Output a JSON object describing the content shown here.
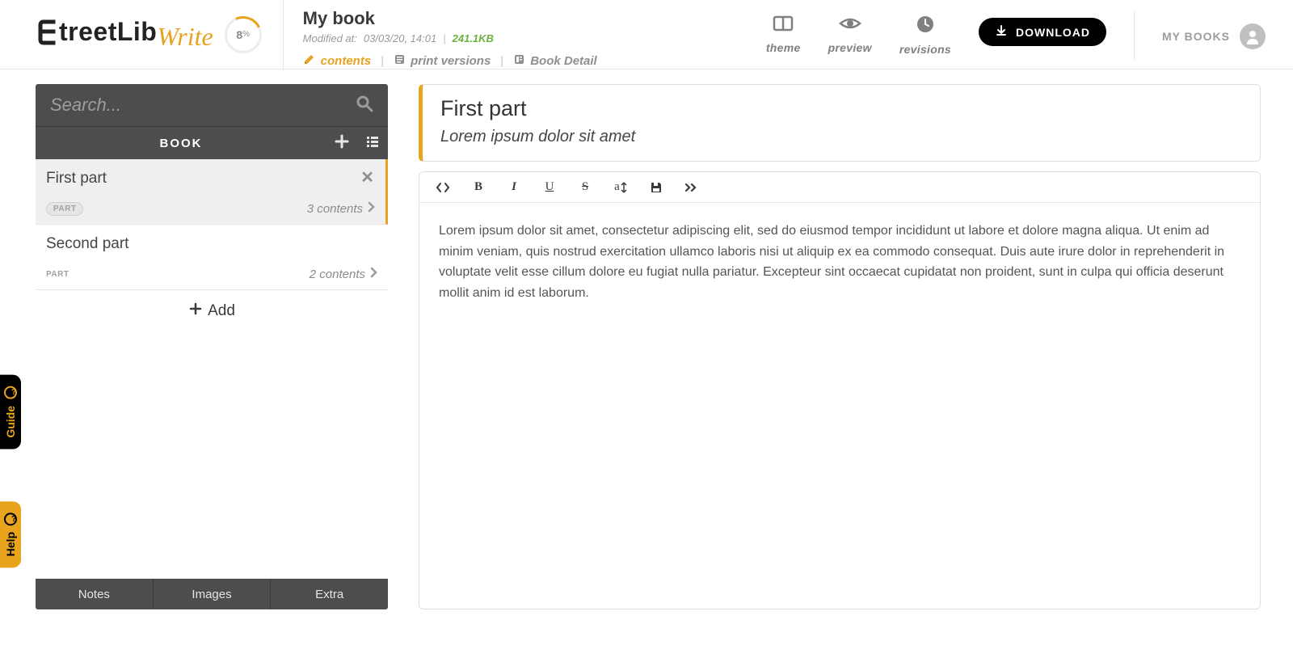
{
  "header": {
    "logo_brand": "treetLib",
    "logo_write": "Write",
    "progress_value": "8",
    "progress_unit": "%",
    "book_title": "My book",
    "modified_label": "Modified at:",
    "modified_at": "03/03/20, 14:01",
    "file_size": "241.1KB",
    "tabs": {
      "contents": "contents",
      "print_versions": "print versions",
      "book_detail": "Book Detail"
    },
    "actions": {
      "theme": "theme",
      "preview": "preview",
      "revisions": "revisions",
      "download": "DOWNLOAD",
      "my_books": "MY BOOKS"
    }
  },
  "sidebar": {
    "search_placeholder": "Search...",
    "book_label": "BOOK",
    "parts": [
      {
        "title": "First part",
        "badge": "PART",
        "count": "3 contents"
      },
      {
        "title": "Second part",
        "badge": "PART",
        "count": "2 contents"
      }
    ],
    "add_label": "Add",
    "bottom": {
      "notes": "Notes",
      "images": "Images",
      "extra": "Extra"
    }
  },
  "editor": {
    "title": "First part",
    "subtitle": "Lorem ipsum dolor sit amet",
    "toolbar": {
      "bold": "B",
      "italic": "I",
      "underline": "U",
      "strike": "S",
      "fontsize": "a"
    },
    "paragraph": "Lorem ipsum dolor sit amet, consectetur adipiscing elit, sed do eiusmod tempor incididunt ut labore et dolore magna aliqua. Ut enim ad minim veniam, quis nostrud exercitation ullamco laboris nisi ut aliquip ex ea commodo consequat. Duis aute irure dolor in reprehenderit in voluptate velit esse cillum dolore eu fugiat nulla pariatur. Excepteur sint occaecat cupidatat non proident, sunt in culpa qui officia deserunt mollit anim  id est laborum."
  },
  "side_tabs": {
    "guide": "Guide",
    "help": "Help"
  }
}
